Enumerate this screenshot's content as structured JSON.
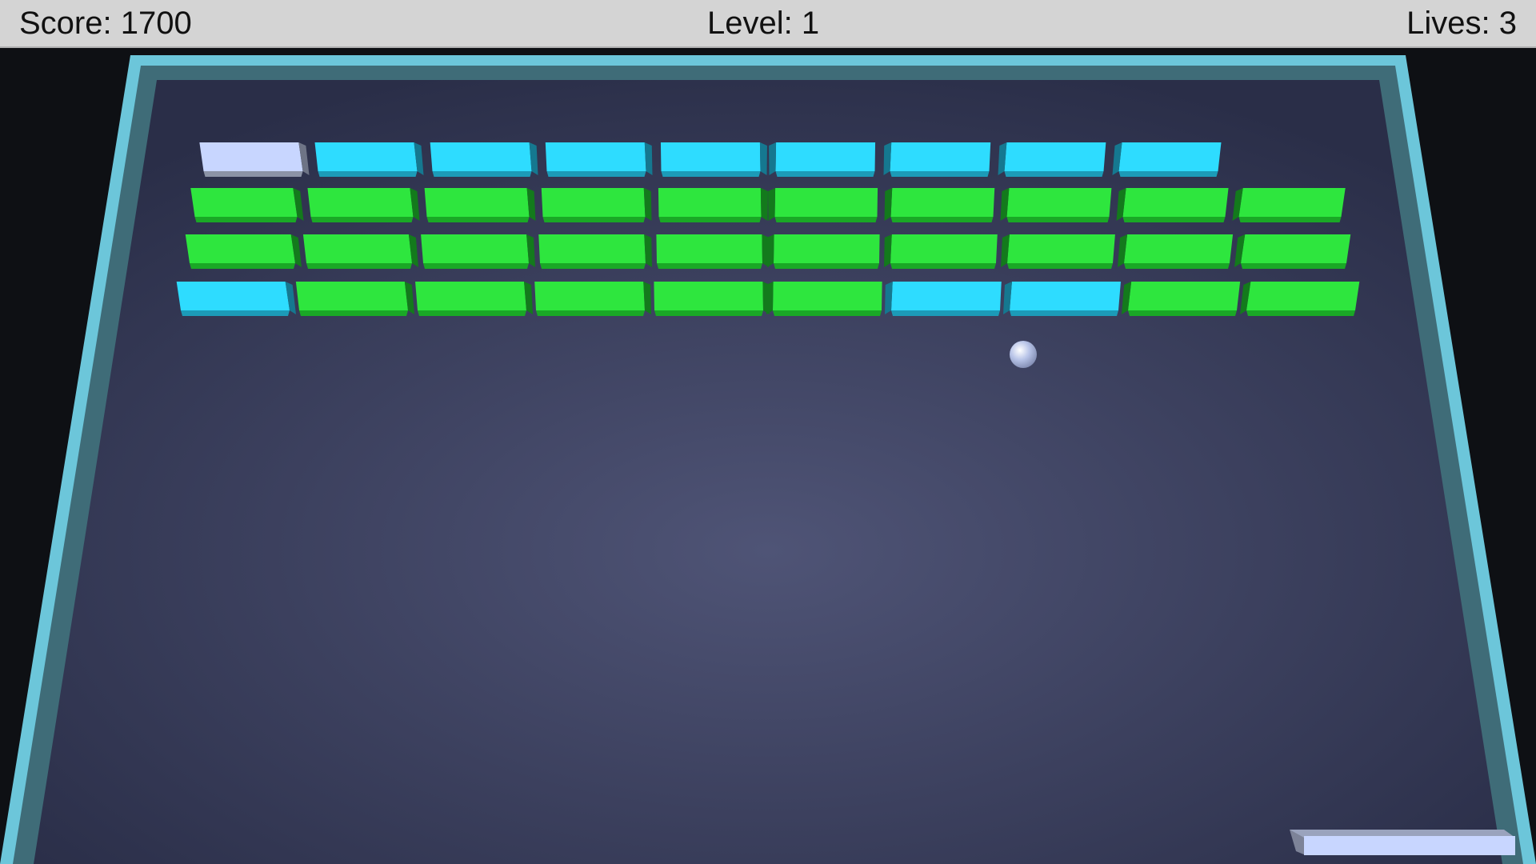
{
  "hud": {
    "score_text": "Score: 1700",
    "level_text": "Level: 1",
    "lives_text": "Lives: 3"
  },
  "game": {
    "score": 1700,
    "level": 1,
    "lives": 3,
    "bricks": [
      [
        "silver",
        "cyan",
        "cyan",
        "cyan",
        "cyan",
        "cyan",
        "cyan",
        "cyan",
        "cyan",
        null
      ],
      [
        "green",
        "green",
        "green",
        "green",
        "green",
        "green",
        "green",
        "green",
        "green",
        "green"
      ],
      [
        "green",
        "green",
        "green",
        "green",
        "green",
        "green",
        "green",
        "green",
        "green",
        "green"
      ],
      [
        "cyan",
        "green",
        "green",
        "green",
        "green",
        "green",
        "cyan",
        "cyan",
        "green",
        "green"
      ]
    ]
  },
  "colors": {
    "background": "#0e1014",
    "floor_center": "#4f5476",
    "floor_edge": "#2a2e48",
    "wall_outer": "#6cc6da",
    "wall_inner": "#3f6c78",
    "hud_bar": "#d4d4d4",
    "green": {
      "top": "#2ee63e",
      "front": "#1aa826",
      "side": "#137a1c"
    },
    "cyan": {
      "top": "#2edcff",
      "front": "#1c9bb8",
      "side": "#157890"
    },
    "silver": {
      "top": "#c8d6ff",
      "front": "#8c93a6",
      "side": "#6e7486"
    },
    "paddle": "#c8d6ff",
    "ball": "#b8c4e8"
  }
}
